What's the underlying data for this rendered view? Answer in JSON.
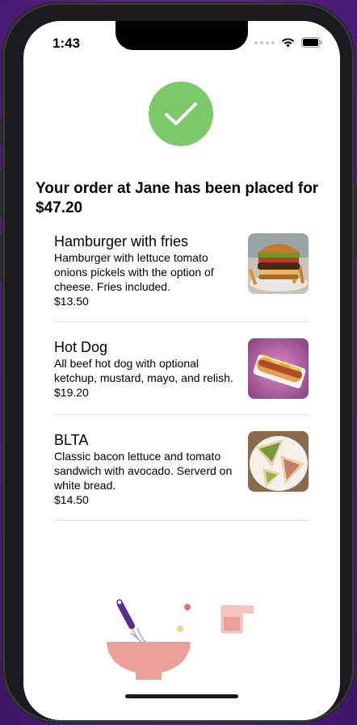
{
  "status_bar": {
    "time": "1:43"
  },
  "confirmation": {
    "headline": "Your order at Jane has been placed for $47.20",
    "icon": "checkmark-icon",
    "accent_color": "#7cc96a"
  },
  "order_items": [
    {
      "name": "Hamburger with fries",
      "description": "Hamburger with lettuce tomato onions pickels with the option of cheese. Fries included.",
      "price": "$13.50",
      "photo": "hamburger-photo"
    },
    {
      "name": "Hot Dog",
      "description": "All beef hot dog with optional ketchup, mustard, mayo, and relish.",
      "price": "$19.20",
      "photo": "hotdog-photo"
    },
    {
      "name": "BLTA",
      "description": "Classic bacon lettuce and tomato sandwich with avocado. Serverd on white bread.",
      "price": "$14.50",
      "photo": "blta-photo"
    }
  ]
}
